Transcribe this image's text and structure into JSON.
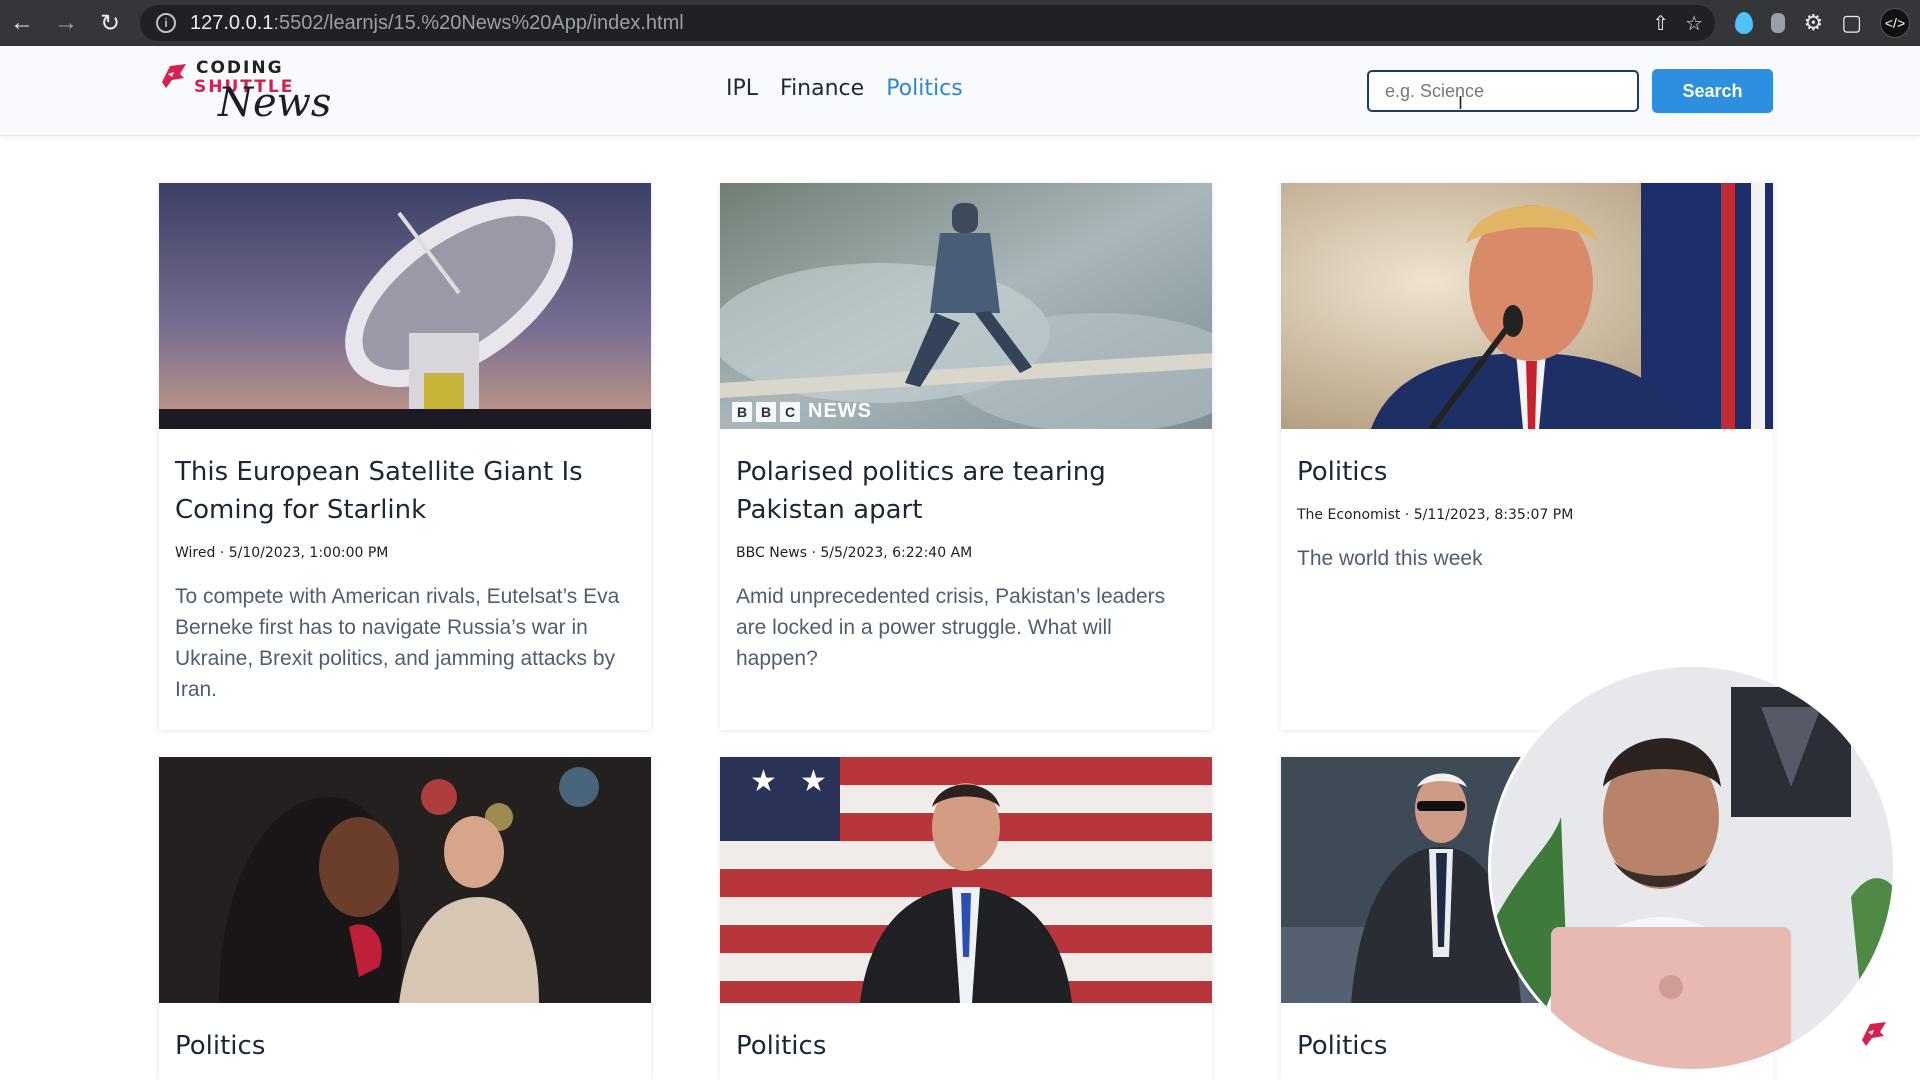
{
  "browser": {
    "url_host": "127.0.0.1",
    "url_path": ":5502/learnjs/15.%20News%20App/index.html"
  },
  "site": {
    "logo": {
      "line1": "CODING",
      "line2": "SHUTTLE",
      "line3": "News"
    },
    "nav": [
      {
        "label": "IPL",
        "active": false
      },
      {
        "label": "Finance",
        "active": false
      },
      {
        "label": "Politics",
        "active": true
      }
    ],
    "search": {
      "placeholder": "e.g. Science",
      "button_label": "Search"
    }
  },
  "articles": [
    {
      "title": "This European Satellite Giant Is Coming for Starlink",
      "meta": "Wired · 5/10/2023, 1:00:00 PM",
      "description": "To compete with American rivals, Eutelsat’s Eva Berneke first has to navigate Russia’s war in Ukraine, Brexit politics, and jamming attacks by Iran.",
      "image_subject": "satellite-dish"
    },
    {
      "title": "Polarised politics are tearing Pakistan apart",
      "meta": "BBC News · 5/5/2023, 6:22:40 AM",
      "description": "Amid unprecedented crisis, Pakistan’s leaders are locked in a power struggle. What will happen?",
      "image_subject": "protest-smoke",
      "watermark": {
        "letters": [
          "B",
          "B",
          "C"
        ],
        "word": "NEWS"
      }
    },
    {
      "title": "Politics",
      "meta": "The Economist · 5/11/2023, 8:35:07 PM",
      "description": "The world this week",
      "image_subject": "speaker-at-podium"
    },
    {
      "title": "Politics",
      "meta": "",
      "description": "",
      "image_subject": "crowd-night"
    },
    {
      "title": "Politics",
      "meta": "",
      "description": "",
      "image_subject": "man-with-flag"
    },
    {
      "title": "Politics",
      "meta": "",
      "description": "",
      "image_subject": "man-in-suit"
    }
  ],
  "colors": {
    "chrome": "#35363a",
    "accent": "#2d8fe0",
    "nav_active": "#2f86d6",
    "brand_red": "#d6204f"
  }
}
